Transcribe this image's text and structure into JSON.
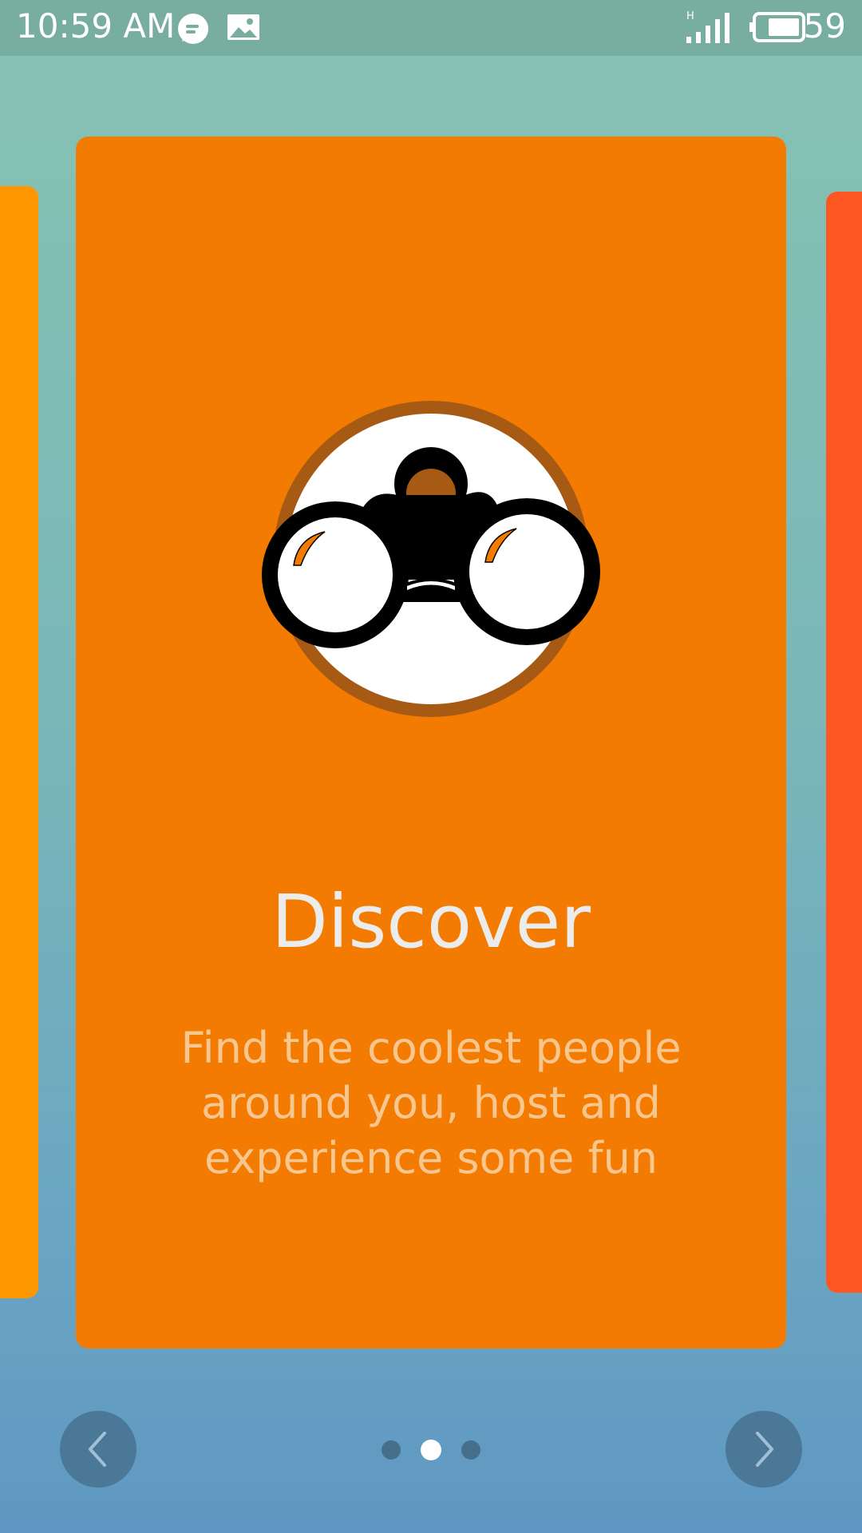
{
  "status_bar": {
    "time": "10:59 AM",
    "icons": [
      "message-bubble-icon",
      "image-icon",
      "signal-icon",
      "battery-icon"
    ],
    "network_type": "H",
    "battery_level": "59"
  },
  "onboarding": {
    "title": "Discover",
    "description": "Find the coolest people around you, host and experience some fun",
    "page_index": 2,
    "page_count": 3
  },
  "navigation": {
    "prev_icon": "chevron-left-icon",
    "next_icon": "chevron-right-icon"
  },
  "colors": {
    "card_main": "#f37b01",
    "card_left": "#ff9800",
    "card_right": "#ff5722",
    "nav_button": "#4a7896"
  }
}
